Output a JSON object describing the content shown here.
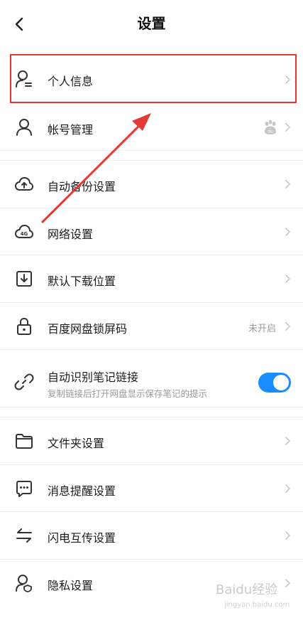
{
  "header": {
    "title": "设置"
  },
  "rows": [
    {
      "label": "个人信息"
    },
    {
      "label": "帐号管理"
    },
    {
      "label": "自动备份设置"
    },
    {
      "label": "网络设置",
      "icon_text": "4G"
    },
    {
      "label": "默认下载位置"
    },
    {
      "label": "百度网盘锁屏码",
      "status": "未开启"
    },
    {
      "label": "自动识别笔记链接",
      "sub": "复制链接后打开网盘显示保存笔记的提示",
      "toggle_on": true
    },
    {
      "label": "文件夹设置"
    },
    {
      "label": "消息提醒设置"
    },
    {
      "label": "闪电互传设置"
    },
    {
      "label": "隐私设置"
    }
  ],
  "account_badge_text": "du",
  "watermark": {
    "text": "Baidu经验",
    "url_text": "jingyan.baidu.com"
  },
  "colors": {
    "accent": "#1a8cff",
    "annotation": "#e53935"
  }
}
